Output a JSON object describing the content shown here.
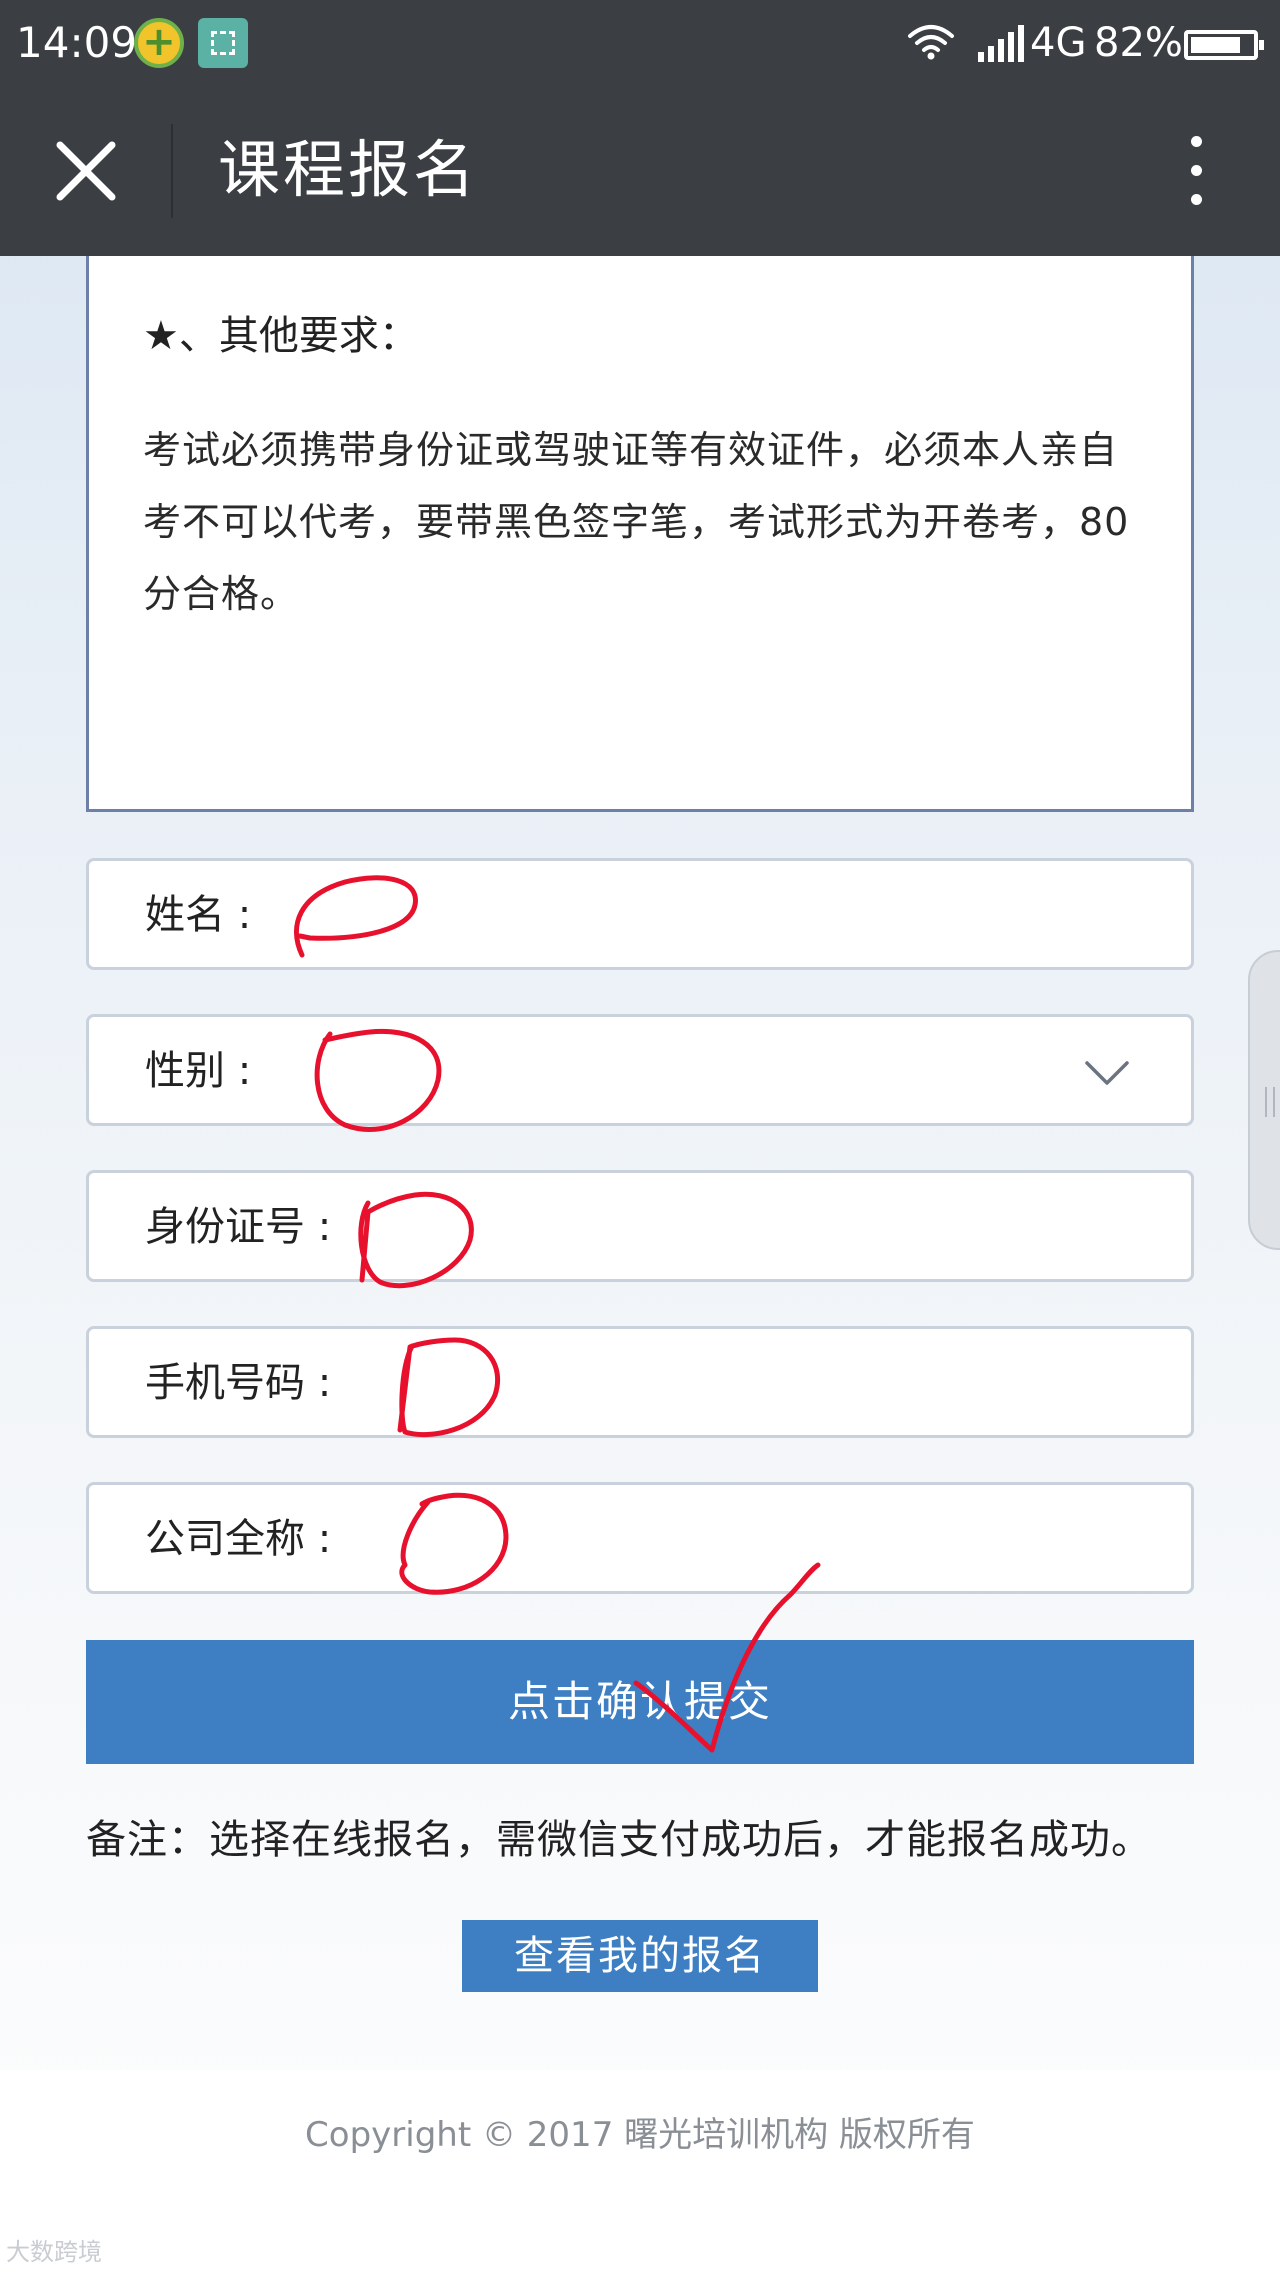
{
  "status_bar": {
    "time": "14:09",
    "network": "4G",
    "battery": "82%",
    "battery_level": 0.82
  },
  "header": {
    "title": "课程报名"
  },
  "requirements": {
    "heading": "★、其他要求：",
    "text": "考试必须携带身份证或驾驶证等有效证件，必须本人亲自考不可以代考，要带黑色签字笔，考试形式为开卷考，80分合格。"
  },
  "form": {
    "name_label": "姓名 :",
    "gender_label": "性别 :",
    "id_label": "身份证号 :",
    "phone_label": "手机号码 :",
    "company_label": "公司全称 :",
    "submit_label": "点击确认提交"
  },
  "note": "备注：选择在线报名，需微信支付成功后，才能报名成功。",
  "view_button": "查看我的报名",
  "footer": {
    "copyright": "Copyright © 2017 曙光培训机构 版权所有"
  },
  "watermark": "大数跨境",
  "colors": {
    "header_bg": "#3b3f44",
    "primary_button": "#3d7fc2",
    "annotation_red": "#e8112d"
  }
}
